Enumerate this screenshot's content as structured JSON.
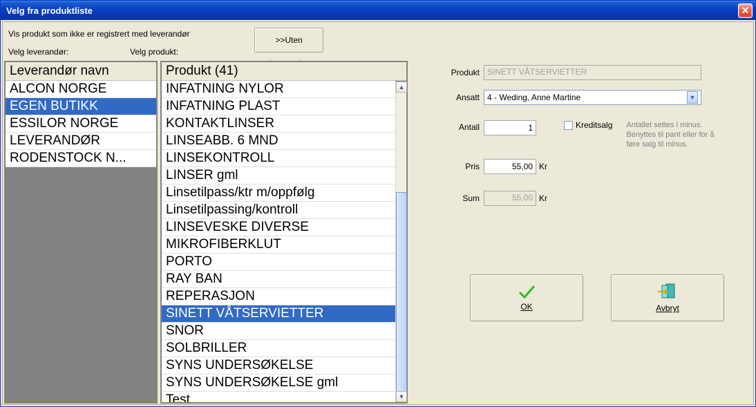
{
  "window": {
    "title": "Velg fra produktliste"
  },
  "top": {
    "line1": "Vis produkt som ikke er registrert med leverandør",
    "velg_leverandor": "Velg leverandør:",
    "velg_produkt": "Velg produkt:",
    "uten_btn": ">>Uten leverandør"
  },
  "supplier_list": {
    "header": "Leverandør navn",
    "items": [
      {
        "label": "ALCON NORGE",
        "selected": false
      },
      {
        "label": "EGEN BUTIKK",
        "selected": true
      },
      {
        "label": "ESSILOR NORGE",
        "selected": false
      },
      {
        "label": "LEVERANDØR",
        "selected": false
      },
      {
        "label": "RODENSTOCK N...",
        "selected": false
      }
    ]
  },
  "product_list": {
    "header": "Produkt (41)",
    "items": [
      {
        "label": "INFATNING NYLOR",
        "selected": false
      },
      {
        "label": "INFATNING PLAST",
        "selected": false
      },
      {
        "label": "KONTAKTLINSER",
        "selected": false
      },
      {
        "label": "LINSEABB. 6 MND",
        "selected": false
      },
      {
        "label": "LINSEKONTROLL",
        "selected": false
      },
      {
        "label": "LINSER gml",
        "selected": false
      },
      {
        "label": "Linsetilpass/ktr m/oppfølg",
        "selected": false
      },
      {
        "label": "Linsetilpassing/kontroll",
        "selected": false
      },
      {
        "label": "LINSEVESKE DIVERSE",
        "selected": false
      },
      {
        "label": "MIKROFIBERKLUT",
        "selected": false
      },
      {
        "label": "PORTO",
        "selected": false
      },
      {
        "label": "RAY BAN",
        "selected": false
      },
      {
        "label": "REPERASJON",
        "selected": false
      },
      {
        "label": "SINETT VÅTSERVIETTER",
        "selected": true
      },
      {
        "label": "SNOR",
        "selected": false
      },
      {
        "label": "SOLBRILLER",
        "selected": false
      },
      {
        "label": "SYNS UNDERSØKELSE",
        "selected": false
      },
      {
        "label": "SYNS UNDERSØKELSE gml",
        "selected": false
      },
      {
        "label": "Test",
        "selected": false
      }
    ]
  },
  "form": {
    "produkt_label": "Produkt",
    "produkt_value": "SINETT VÅTSERVIETTER",
    "ansatt_label": "Ansatt",
    "ansatt_value": "4 -  Weding, Anne Martine",
    "antall_label": "Antall",
    "antall_value": "1",
    "kredit_label": "Kreditsalg",
    "hint": "Antallet settes i minus. Benyttes til pant eller for å føre salg til minus.",
    "pris_label": "Pris",
    "pris_value": "55,00",
    "sum_label": "Sum",
    "sum_value": "55,00",
    "unit": "Kr"
  },
  "buttons": {
    "ok": "OK",
    "cancel": "Avbryt"
  }
}
